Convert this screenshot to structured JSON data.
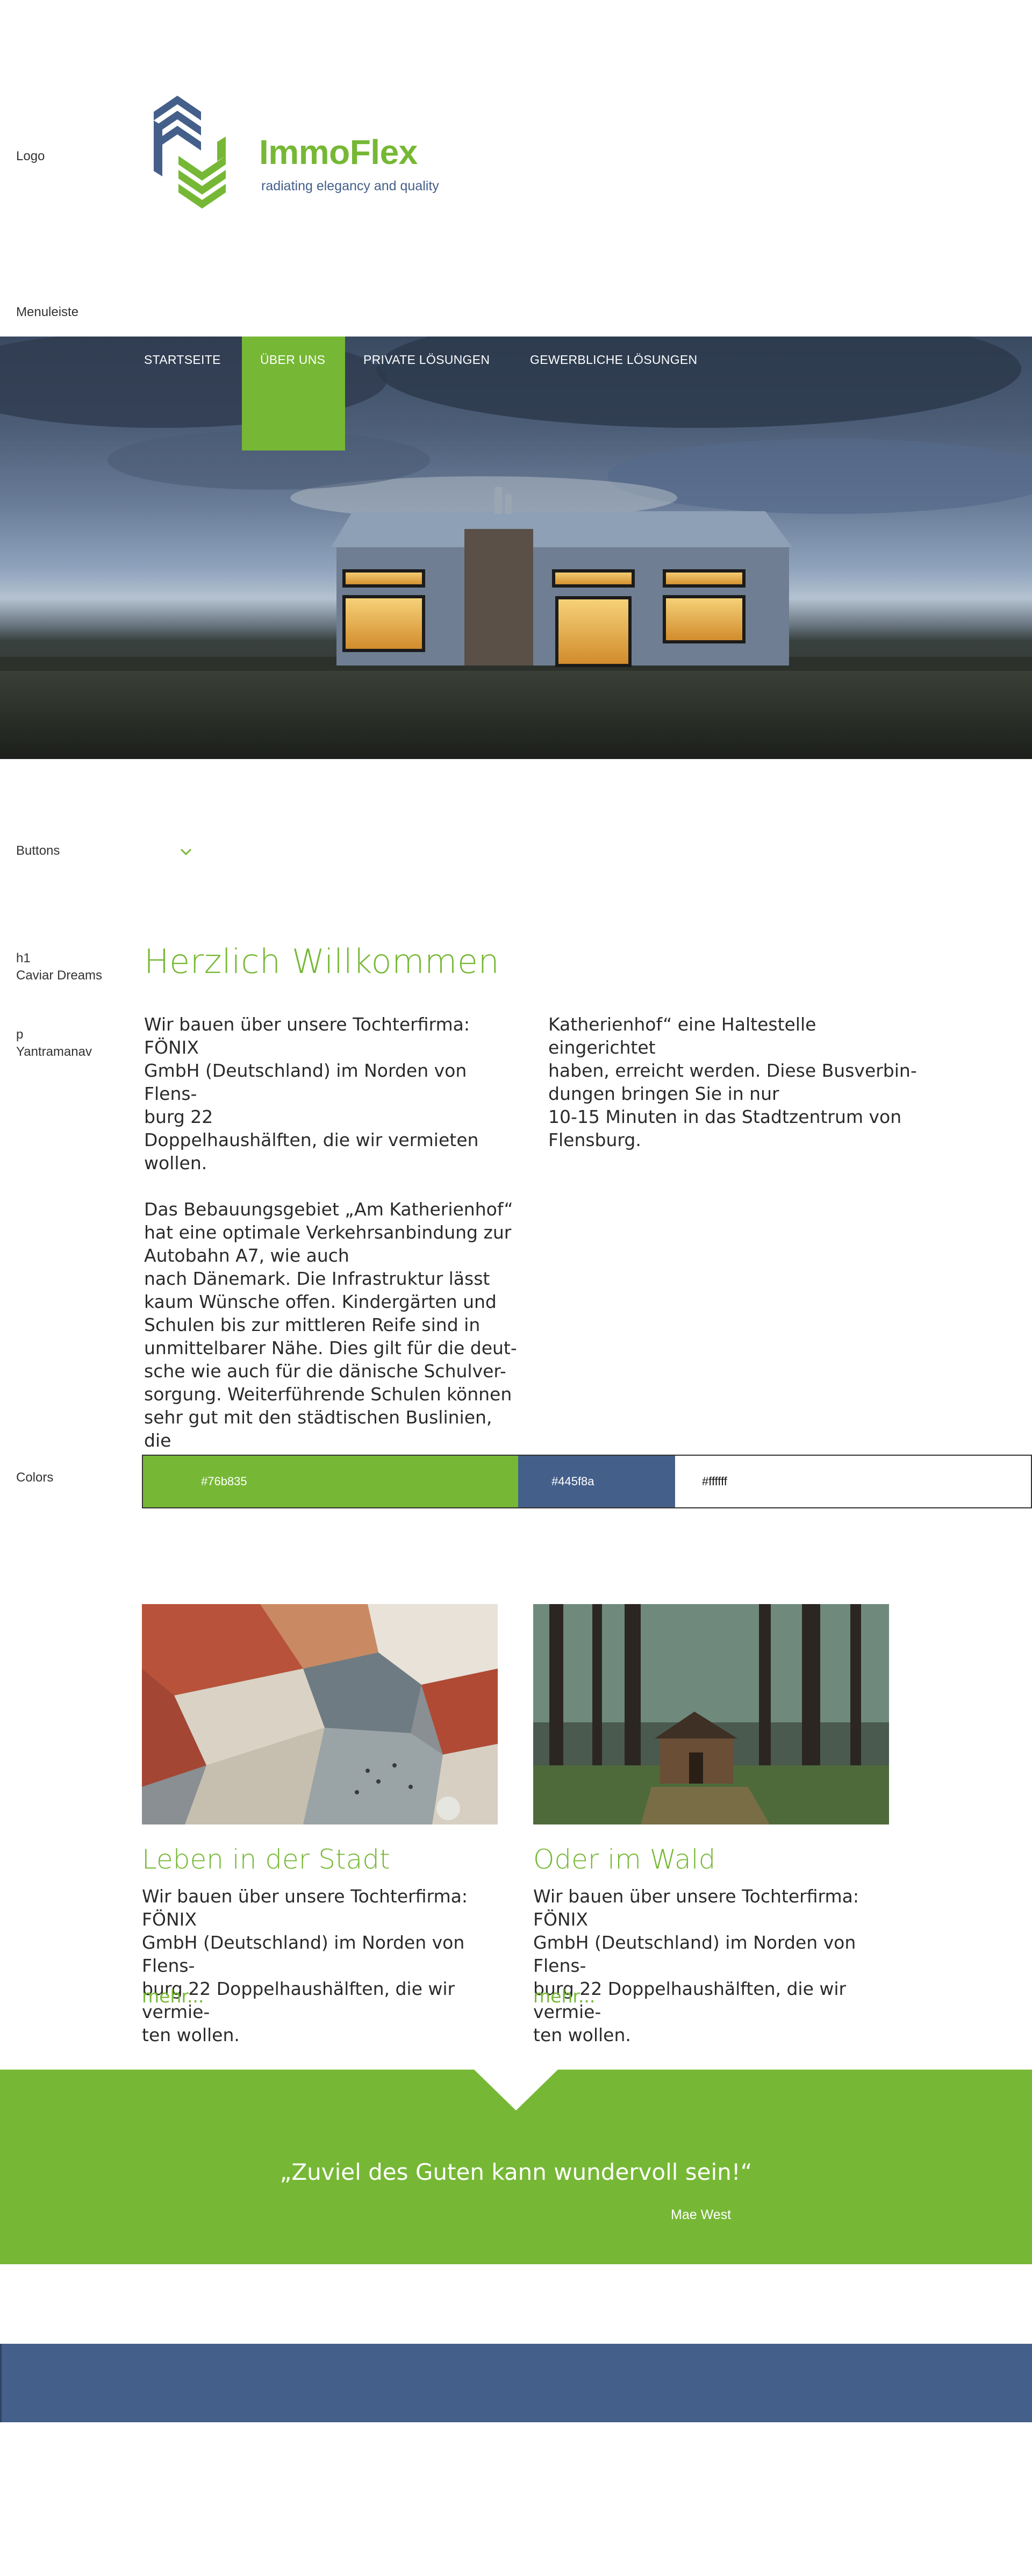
{
  "labels": {
    "logo": "Logo",
    "menu": "Menuleiste",
    "buttons": "Buttons",
    "h1_tag": "h1",
    "h1_font": "Caviar Dreams",
    "p_tag": "p",
    "p_font": "Yantramanav",
    "colors": "Colors"
  },
  "brand": {
    "name": "ImmoFlex",
    "tagline": "radiating elegancy and quality"
  },
  "nav": {
    "items": [
      {
        "label": "STARTSEITE",
        "active": false
      },
      {
        "label": "ÜBER UNS",
        "active": true
      },
      {
        "label": "PRIVATE LÖSUNGEN",
        "active": false
      },
      {
        "label": "GEWERBLICHE LÖSUNGEN",
        "active": false
      }
    ]
  },
  "buttons": {
    "icon": "chevron-down-icon"
  },
  "content": {
    "heading": "Herzlich Willkommen",
    "col1": "Wir bauen über unsere Tochterfirma: FÖNIX\nGmbH (Deutschland) im Norden von Flens-\nburg 22\nDoppelhaushälften, die wir vermieten\nwollen.\n\nDas Bebauungsgebiet „Am Katherienhof“\nhat eine optimale Verkehrsanbindung zur\nAutobahn A7, wie auch\nnach Dänemark. Die Infrastruktur lässt\nkaum Wünsche offen. Kindergärten und\nSchulen bis zur mittleren Reife sind in\nunmittelbarer Nähe. Dies gilt für die deut-\nsche wie auch für die dänische Schulver-\nsorgung. Weiterführende Schulen können\nsehr gut mit den städtischen Buslinien, die\ndirekt am Bebauungsgebiet „Am",
    "col2": "Katherienhof“ eine Haltestelle eingerichtet\nhaben, erreicht werden. Diese Busverbin-\ndungen bringen Sie in nur\n10-15 Minuten in das Stadtzentrum von\nFlensburg."
  },
  "colors": [
    {
      "hex": "#76b835",
      "label": "#76b835"
    },
    {
      "hex": "#445f8a",
      "label": "#445f8a"
    },
    {
      "hex": "#ffffff",
      "label": "#ffffff"
    }
  ],
  "cards": [
    {
      "title": "Leben in der Stadt",
      "text": "Wir bauen über unsere Tochterfirma: FÖNIX\nGmbH (Deutschland) im Norden von Flens-\nburg 22 Doppelhaushälften, die wir vermie-\nten wollen.",
      "more": "mehr..."
    },
    {
      "title": "Oder im Wald",
      "text": "Wir bauen über unsere Tochterfirma: FÖNIX\nGmbH (Deutschland) im Norden von Flens-\nburg 22 Doppelhaushälften, die wir vermie-\nten wollen.",
      "more": "mehr..."
    }
  ],
  "quote": {
    "text": "„Zuviel des Guten kann wundervoll sein!“",
    "author": "Mae West"
  }
}
